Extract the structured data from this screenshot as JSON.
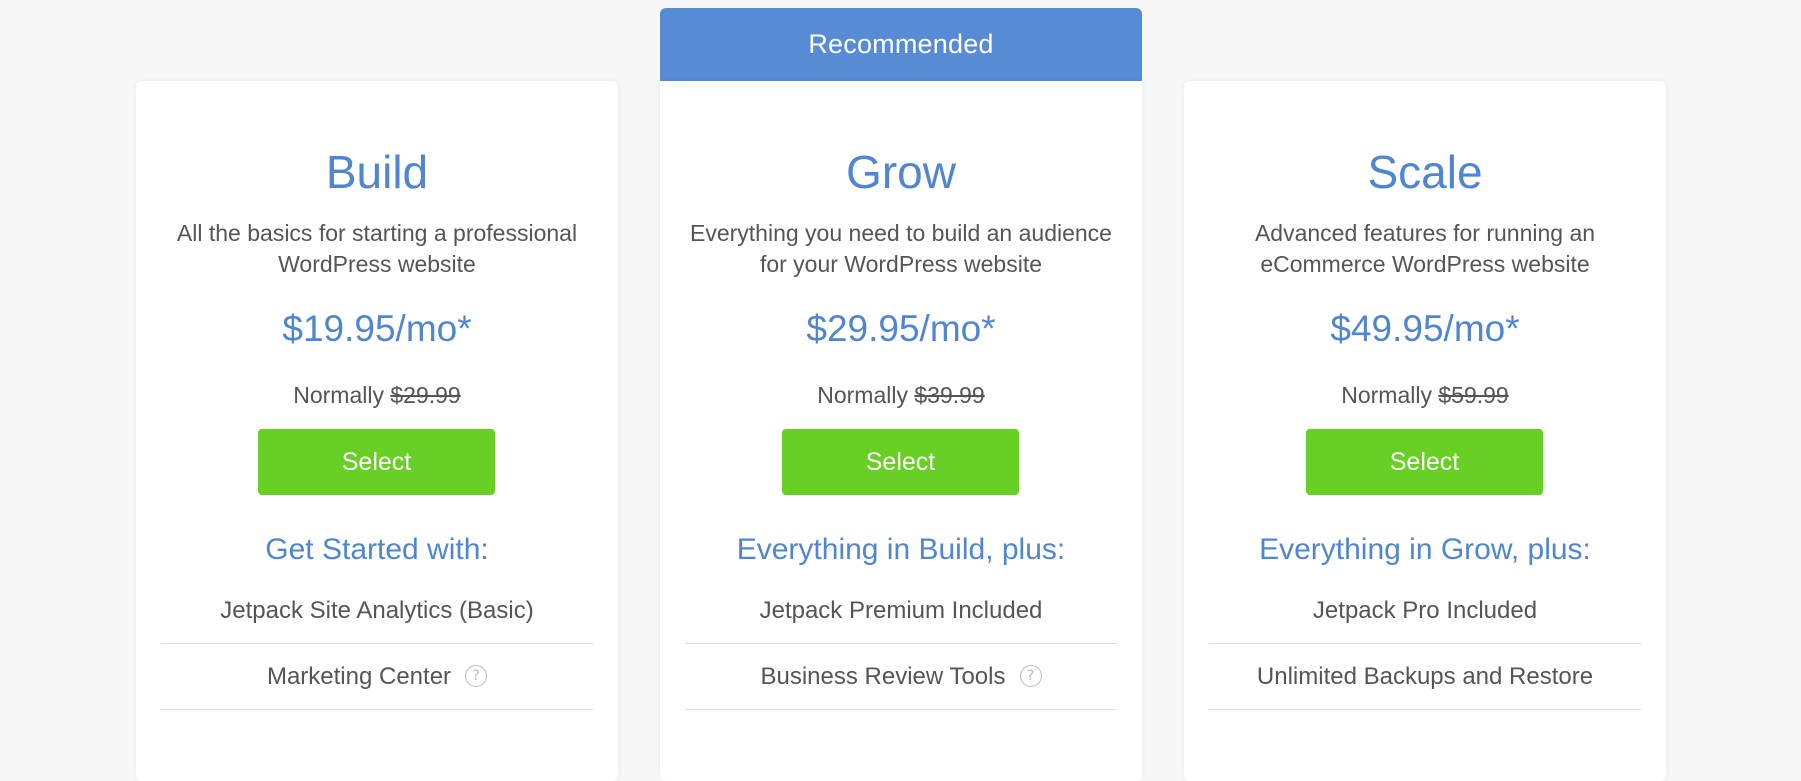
{
  "ribbon": {
    "label": "Recommended"
  },
  "colors": {
    "accent": "#4f86cf",
    "ribbon": "#578bd6",
    "button": "#68d024",
    "text": "#555555",
    "background": "#f7f7f7"
  },
  "plans": [
    {
      "name": "Build",
      "description": "All the basics for starting a professional WordPress website",
      "price": "$19.95/mo*",
      "normally_label": "Normally",
      "normally_price": "$29.99",
      "select_label": "Select",
      "features_heading": "Get Started with:",
      "features": [
        {
          "label": "Jetpack Site Analytics (Basic)",
          "help": false
        },
        {
          "label": "Marketing Center",
          "help": true
        }
      ]
    },
    {
      "name": "Grow",
      "description": "Everything you need to build an audience for your WordPress website",
      "price": "$29.95/mo*",
      "normally_label": "Normally",
      "normally_price": "$39.99",
      "select_label": "Select",
      "features_heading": "Everything in Build, plus:",
      "features": [
        {
          "label": "Jetpack Premium Included",
          "help": false
        },
        {
          "label": "Business Review Tools",
          "help": true
        }
      ]
    },
    {
      "name": "Scale",
      "description": "Advanced features for running an eCommerce WordPress website",
      "price": "$49.95/mo*",
      "normally_label": "Normally",
      "normally_price": "$59.99",
      "select_label": "Select",
      "features_heading": "Everything in Grow, plus:",
      "features": [
        {
          "label": "Jetpack Pro Included",
          "help": false
        },
        {
          "label": "Unlimited Backups and Restore",
          "help": false
        }
      ]
    }
  ],
  "help_icon_glyph": "?"
}
